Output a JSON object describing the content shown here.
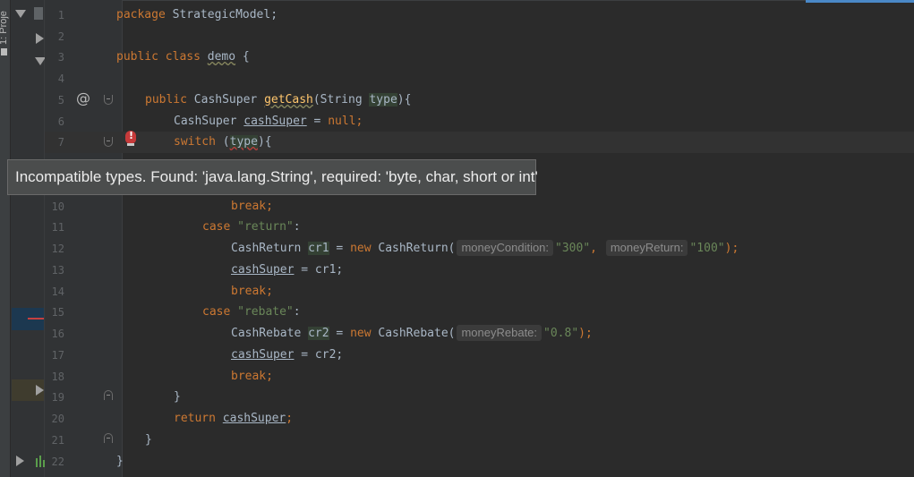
{
  "sidebar": {
    "tool_window_label": "1: Proje"
  },
  "editor": {
    "lines": [
      {
        "n": "1"
      },
      {
        "n": "2"
      },
      {
        "n": "3"
      },
      {
        "n": "4"
      },
      {
        "n": "5"
      },
      {
        "n": "6"
      },
      {
        "n": "7"
      },
      {
        "n": "10"
      },
      {
        "n": "11"
      },
      {
        "n": "12"
      },
      {
        "n": "13"
      },
      {
        "n": "14"
      },
      {
        "n": "15"
      },
      {
        "n": "16"
      },
      {
        "n": "17"
      },
      {
        "n": "18"
      },
      {
        "n": "19"
      },
      {
        "n": "20"
      },
      {
        "n": "21"
      },
      {
        "n": "22"
      }
    ],
    "code": {
      "l1_kw": "package",
      "l1_pkg": " StrategicModel;",
      "l3_kw": "public class",
      "l3_name": "demo",
      "l3_rest": " {",
      "l5_kw": "public",
      "l5_type": " CashSuper ",
      "l5_method": "getCash",
      "l5_open": "(String ",
      "l5_param": "type",
      "l5_close": "){",
      "l6_type": "CashSuper ",
      "l6_var": "cashSuper",
      "l6_eq": " = ",
      "l6_null": "null",
      "l6_semi": ";",
      "l7_kw": "switch",
      "l7_open": " (",
      "l7_param": "type",
      "l7_close": "){",
      "l10_break": "break",
      "l10_semi": ";",
      "l11_case": "case",
      "l11_str": "\"return\"",
      "l11_colon": ":",
      "l12_type": "CashReturn ",
      "l12_var": "cr1",
      "l12_eq": " = ",
      "l12_new": "new",
      "l12_ctor": " CashReturn(",
      "l12_hint1": "moneyCondition:",
      "l12_arg1": "\"300\"",
      "l12_comma": ",",
      "l12_hint2": "moneyReturn:",
      "l12_arg2": "\"100\"",
      "l12_end": ");",
      "l13_var": "cashSuper",
      "l13_rest": " = cr1;",
      "l14_break": "break",
      "l14_semi": ";",
      "l15_case": "case",
      "l15_str": "\"rebate\"",
      "l15_colon": ":",
      "l16_type": "CashRebate ",
      "l16_var": "cr2",
      "l16_eq": " = ",
      "l16_new": "new",
      "l16_ctor": " CashRebate(",
      "l16_hint": "moneyRebate:",
      "l16_arg": "\"0.8\"",
      "l16_end": ");",
      "l17_var": "cashSuper",
      "l17_rest": " = cr2;",
      "l18_break": "break",
      "l18_semi": ";",
      "l19_brace": "}",
      "l20_kw": "return",
      "l20_var": "cashSuper",
      "l20_semi": ";",
      "l21_brace": "}",
      "l22_brace": "}"
    }
  },
  "tooltip": {
    "message": "Incompatible types. Found: 'java.lang.String', required: 'byte, char, short or int'"
  },
  "colors": {
    "background": "#2b2b2b",
    "keyword": "#cc7832",
    "string": "#6a8759",
    "text": "#a9b7c6",
    "line_number": "#606366"
  }
}
